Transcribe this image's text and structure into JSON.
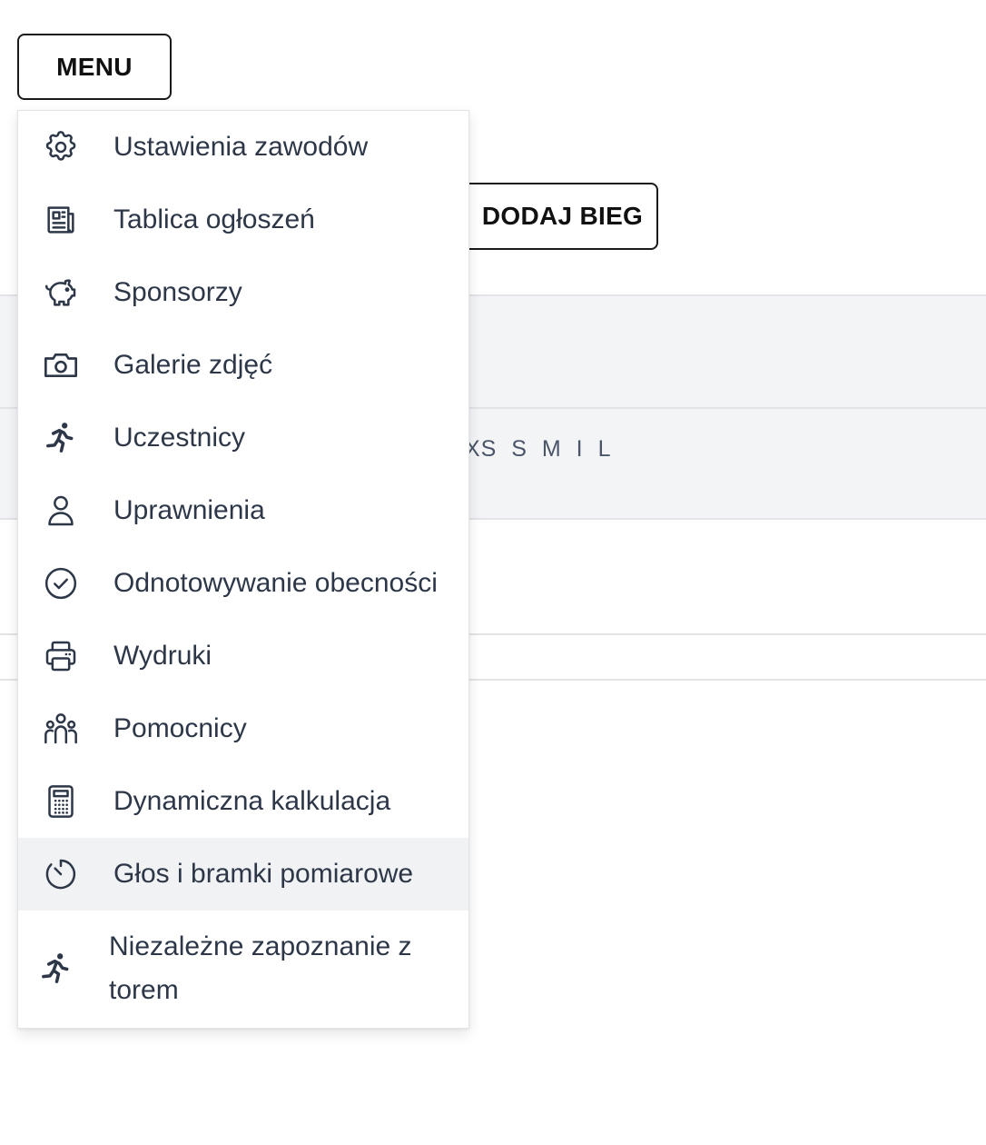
{
  "menu_button": {
    "label": "MENU"
  },
  "add_run_button": {
    "label": "DODAJ BIEG"
  },
  "table": {
    "sizes": "XS S M I L"
  },
  "dropdown": {
    "items": [
      {
        "label": "Ustawienia zawodów",
        "icon": "gear-icon"
      },
      {
        "label": "Tablica ogłoszeń",
        "icon": "newspaper-icon"
      },
      {
        "label": "Sponsorzy",
        "icon": "piggy-bank-icon"
      },
      {
        "label": "Galerie zdjęć",
        "icon": "camera-icon"
      },
      {
        "label": "Uczestnicy",
        "icon": "runner-icon"
      },
      {
        "label": "Uprawnienia",
        "icon": "user-icon"
      },
      {
        "label": "Odnotowywanie obecności",
        "icon": "check-circle-icon"
      },
      {
        "label": "Wydruki",
        "icon": "printer-icon"
      },
      {
        "label": "Pomocnicy",
        "icon": "people-icon"
      },
      {
        "label": "Dynamiczna kalkulacja",
        "icon": "calculator-icon"
      },
      {
        "label": "Głos i bramki pomiarowe",
        "icon": "timer-icon",
        "active": true
      },
      {
        "label": "Niezależne zapoznanie z torem",
        "icon": "runner-icon"
      }
    ]
  },
  "colors": {
    "text": "#2d3748",
    "active_bg": "#f1f2f4",
    "border": "#1a1a1a"
  }
}
